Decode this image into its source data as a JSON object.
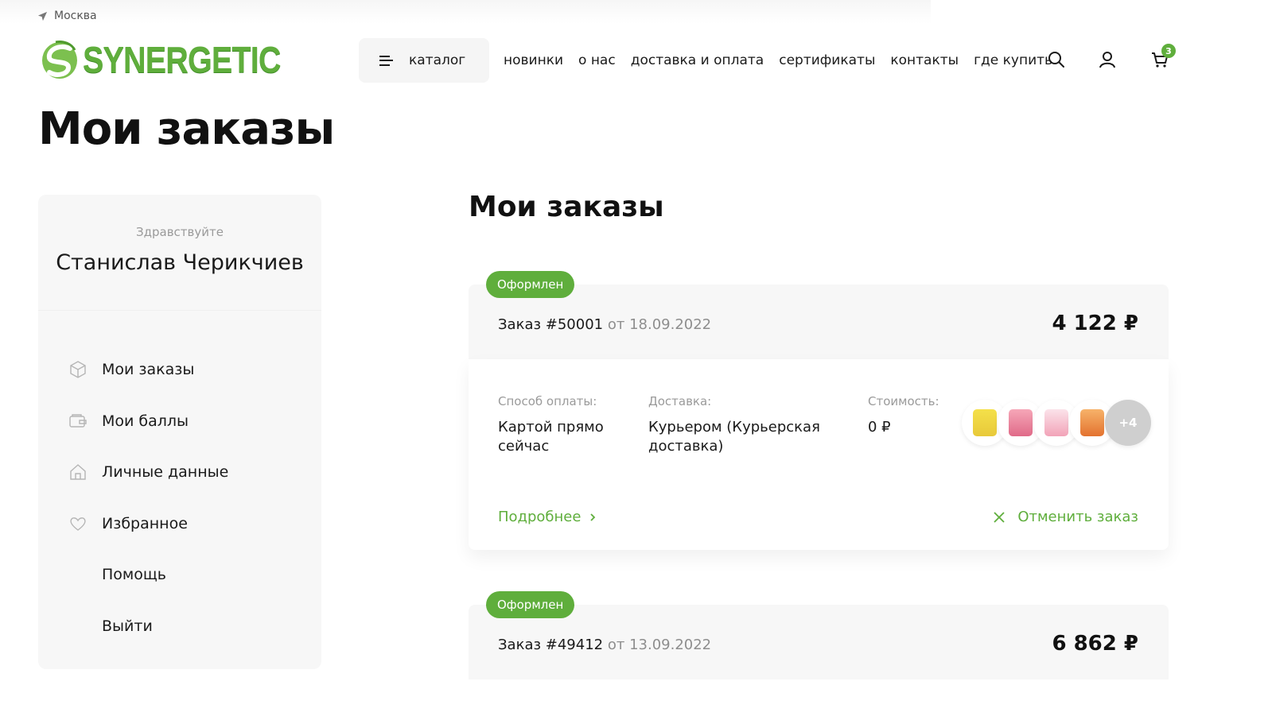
{
  "location": {
    "city": "Москва",
    "icon": "location-arrow-icon"
  },
  "brand": {
    "name": "SYNERGETIC",
    "accent": "#5fae3c"
  },
  "header": {
    "catalog_label": "каталог",
    "nav": [
      "новинки",
      "о нас",
      "доставка и оплата",
      "сертификаты",
      "контакты",
      "где купить"
    ],
    "cart_count": "3"
  },
  "page_title": "Мои заказы",
  "sidebar": {
    "greeting": "Здравствуйте",
    "user_name": "Станислав Черикчиев",
    "items": [
      {
        "label": "Мои заказы",
        "icon": "box-icon"
      },
      {
        "label": "Мои баллы",
        "icon": "wallet-icon"
      },
      {
        "label": "Личные данные",
        "icon": "home-icon"
      },
      {
        "label": "Избранное",
        "icon": "heart-icon"
      },
      {
        "label": "Помощь",
        "icon": ""
      },
      {
        "label": "Выйти",
        "icon": ""
      }
    ]
  },
  "orders_section_title": "Мои заказы",
  "orders": [
    {
      "status": "Оформлен",
      "number": "Заказ #50001",
      "date": "от 18.09.2022",
      "total": "4 122 ₽",
      "payment_label": "Способ оплаты:",
      "payment_value": "Картой прямо сейчас",
      "delivery_label": "Доставка:",
      "delivery_value": "Курьером (Курьерская доставка)",
      "cost_label": "Стоимость:",
      "cost_value": "0 ₽",
      "more_items": "+4",
      "details_link": "Подробнее",
      "cancel_link": "Отменить заказ"
    },
    {
      "status": "Оформлен",
      "number": "Заказ #49412",
      "date": "от 13.09.2022",
      "total": "6 862 ₽"
    }
  ]
}
